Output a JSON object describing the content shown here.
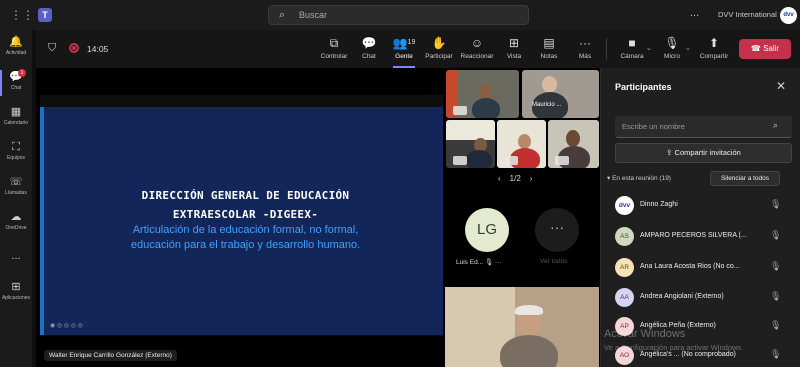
{
  "titlebar": {
    "search_placeholder": "Buscar",
    "org_name": "DVV International",
    "org_avatar": "dvv",
    "more": "..."
  },
  "rail": {
    "items": [
      {
        "label": "Actividad",
        "icon": "bell-icon",
        "glyph": "🔔"
      },
      {
        "label": "Chat",
        "icon": "chat-icon",
        "glyph": "💬",
        "badge": "1"
      },
      {
        "label": "Calendario",
        "icon": "calendar-icon",
        "glyph": "▦"
      },
      {
        "label": "Equipos",
        "icon": "teams-icon",
        "glyph": "⛶"
      },
      {
        "label": "Llamadas",
        "icon": "phone-icon",
        "glyph": "☏"
      },
      {
        "label": "OneDrive",
        "icon": "cloud-icon",
        "glyph": "☁"
      },
      {
        "label": "...",
        "icon": "more-icon",
        "glyph": ""
      },
      {
        "label": "Aplicaciones",
        "icon": "apps-icon",
        "glyph": "⊞"
      }
    ]
  },
  "meeting_toolbar": {
    "timer": "14:05",
    "buttons": [
      {
        "label": "Controlar",
        "icon": "control-icon",
        "glyph": "⧉"
      },
      {
        "label": "Chat",
        "icon": "chat-icon",
        "glyph": "💬"
      },
      {
        "label": "Gente",
        "icon": "people-icon",
        "glyph": "👥",
        "count": "19"
      },
      {
        "label": "Participar",
        "icon": "raise-hand-icon",
        "glyph": "✋"
      },
      {
        "label": "Reaccionar",
        "icon": "react-icon",
        "glyph": "☺"
      },
      {
        "label": "Vista",
        "icon": "view-icon",
        "glyph": "⊞"
      },
      {
        "label": "Notas",
        "icon": "notes-icon",
        "glyph": "▤"
      },
      {
        "label": "Más",
        "icon": "more-icon",
        "glyph": "···"
      }
    ],
    "device_buttons": [
      {
        "label": "Cámara",
        "icon": "camera-icon",
        "glyph": "■"
      },
      {
        "label": "Micro",
        "icon": "mic-off-icon",
        "glyph": "🎙"
      },
      {
        "label": "Compartir",
        "icon": "share-icon",
        "glyph": "⬆"
      }
    ],
    "leave_label": "Salir"
  },
  "slide": {
    "title_line1": "DIRECCIÓN GENERAL DE EDUCACIÓN",
    "title_line2": "EXTRAESCOLAR -DIGEEX-",
    "subtitle_line1": "Articulación de la educación formal, no formal,",
    "subtitle_line2": "educación para el trabajo y desarrollo humano."
  },
  "presenter_name": "Walter Enrique Carrillo González (Externo)",
  "video_grid": {
    "tile_name": "Mauricio ...",
    "pager": "1/2",
    "avatar_initials": "LG",
    "avatar_name": "Luis Ed...",
    "view_all": "Ver todos"
  },
  "participants": {
    "title": "Participantes",
    "search_placeholder": "Escribe un nombre",
    "share_invite": "Compartir invitación",
    "section_label": "En esta reunión (19)",
    "mute_all": "Silenciar a todos",
    "list": [
      {
        "name": "Dinno Zaghi",
        "initials": "dvv",
        "color": "#ffffff",
        "text": "#1a3b8c"
      },
      {
        "name": "AMPARO PECEROS SILVERA (...",
        "initials": "AS",
        "color": "#cfd9c0",
        "text": "#3d4a2a"
      },
      {
        "name": "Ana Laura Acosta Rios (No co...",
        "initials": "AR",
        "color": "#f6e2b5",
        "text": "#6b4c0b"
      },
      {
        "name": "Andrea Angiolani (Externo)",
        "initials": "AA",
        "color": "#d7d3f0",
        "text": "#3b3470"
      },
      {
        "name": "Angélica Peña (Externo)",
        "initials": "AP",
        "color": "#f4d6d9",
        "text": "#7a2a34"
      },
      {
        "name": "Angélica's ...",
        "name_suffix": "(No comprobado)",
        "initials": "AO",
        "color": "#f4d6d9",
        "text": "#7a2a34"
      }
    ]
  },
  "watermark": {
    "line1": "Activar Windows",
    "line2": "Ve a Configuración para activar Windows."
  }
}
